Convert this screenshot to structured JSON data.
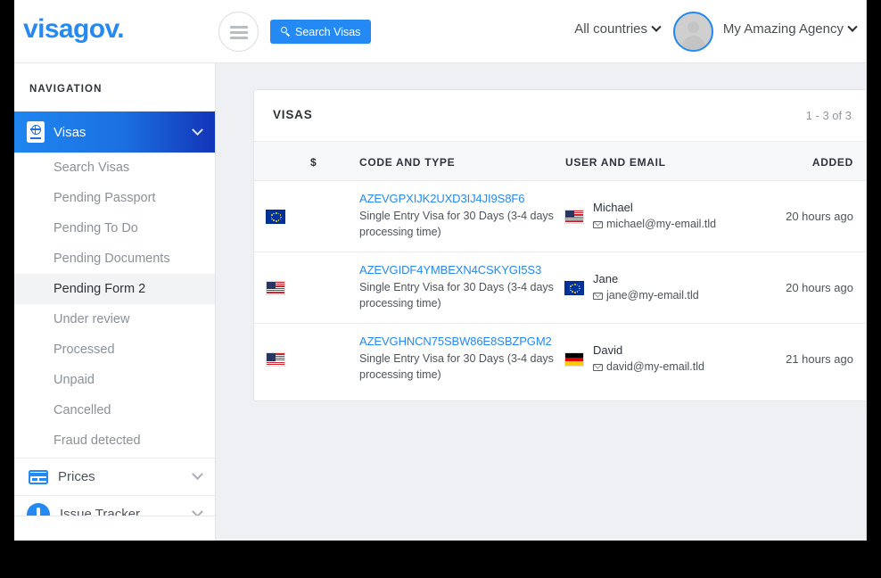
{
  "header": {
    "brand": "visagov.",
    "menu_toggle_icon": "hamburger-icon",
    "search_button_label": "Search Visas",
    "search_icon": "search-icon",
    "country_filter_label": "All countries",
    "agency_label": "My Amazing Agency",
    "avatar_icon": "user-avatar-icon",
    "accent_color": "#2489f2"
  },
  "sidebar": {
    "heading": "NAVIGATION",
    "active_group": {
      "label": "Visas",
      "icon": "passport-globe-icon",
      "chevron": "chevron-down-icon"
    },
    "sub_items": [
      {
        "label": "Search Visas",
        "active": false
      },
      {
        "label": "Pending Passport",
        "active": false
      },
      {
        "label": "Pending To Do",
        "active": false
      },
      {
        "label": "Pending Documents",
        "active": false
      },
      {
        "label": "Pending Form 2",
        "active": true
      },
      {
        "label": "Under review",
        "active": false
      },
      {
        "label": "Processed",
        "active": false
      },
      {
        "label": "Unpaid",
        "active": false
      },
      {
        "label": "Cancelled",
        "active": false
      },
      {
        "label": "Fraud detected",
        "active": false
      }
    ],
    "groups": [
      {
        "label": "Prices",
        "icon": "credit-card-icon",
        "chevron": "chevron-down-icon"
      },
      {
        "label": "Issue Tracker",
        "icon": "alert-circle-icon",
        "chevron": "chevron-down-icon"
      }
    ]
  },
  "main": {
    "card_title": "VISAS",
    "pagination": "1 - 3 of 3",
    "columns": {
      "price": "$",
      "code_and_type": "CODE AND TYPE",
      "user_and_email": "USER AND EMAIL",
      "added": "ADDED"
    },
    "rows": [
      {
        "destination_flag": "eu",
        "status_icon": "check-circle-icon",
        "code": "AZEVGPXIJK2UXD3IJ4JI9S8F6",
        "type": "Single Entry Visa for 30 Days (3-4 days processing time)",
        "user_flag": "us",
        "user_name": "Michael",
        "user_email": "michael@my-email.tld",
        "email_icon": "envelope-icon",
        "added": "20 hours ago"
      },
      {
        "destination_flag": "us",
        "status_icon": "check-circle-icon",
        "code": "AZEVGIDF4YMBEXN4CSKYGI5S3",
        "type": "Single Entry Visa for 30 Days (3-4 days processing time)",
        "user_flag": "eu",
        "user_name": "Jane",
        "user_email": "jane@my-email.tld",
        "email_icon": "envelope-icon",
        "added": "20 hours ago"
      },
      {
        "destination_flag": "us",
        "status_icon": "check-circle-icon",
        "code": "AZEVGHNCN75SBW86E8SBZPGM2",
        "type": "Single Entry Visa for 30 Days (3-4 days processing time)",
        "user_flag": "de",
        "user_name": "David",
        "user_email": "david@my-email.tld",
        "email_icon": "envelope-icon",
        "added": "21 hours ago"
      }
    ]
  }
}
